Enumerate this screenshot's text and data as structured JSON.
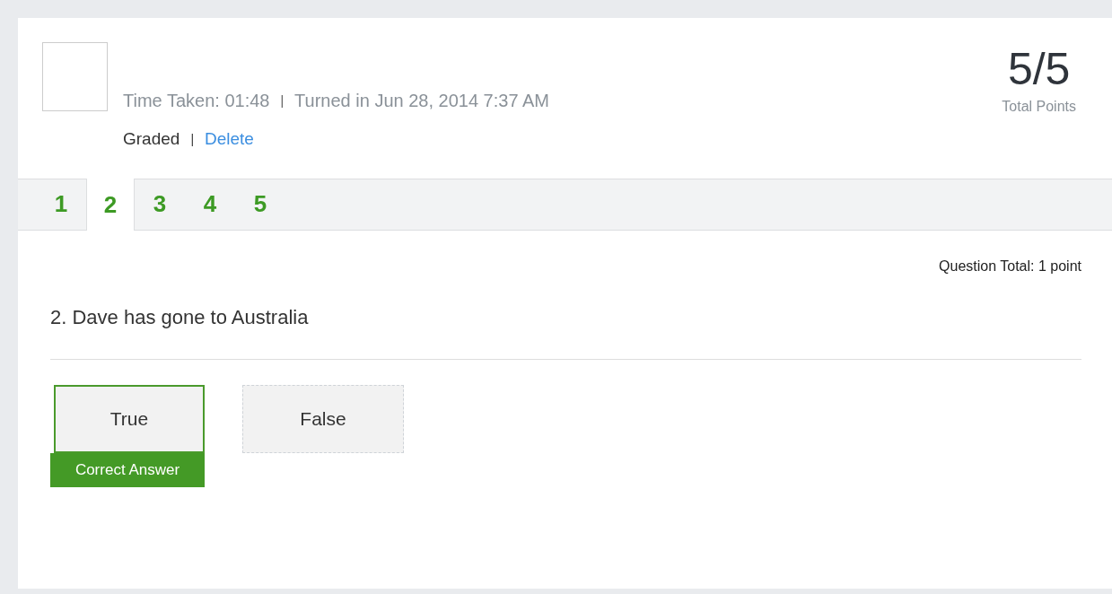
{
  "header": {
    "time_taken": "Time Taken: 01:48",
    "separator_1": "|",
    "turned_in": "Turned in Jun 28, 2014 7:37 AM",
    "status": "Graded",
    "separator_2": "|",
    "delete_link": "Delete",
    "score": "5/5",
    "score_label": "Total Points"
  },
  "tabs": [
    {
      "label": "1",
      "selected": false
    },
    {
      "label": "2",
      "selected": true
    },
    {
      "label": "3",
      "selected": false
    },
    {
      "label": "4",
      "selected": false
    },
    {
      "label": "5",
      "selected": false
    }
  ],
  "question_total": "Question Total: 1 point",
  "question": "2. Dave has gone to Australia",
  "answers": [
    {
      "label": "True",
      "correct": true,
      "badge": "Correct Answer"
    },
    {
      "label": "False",
      "correct": false
    }
  ]
}
